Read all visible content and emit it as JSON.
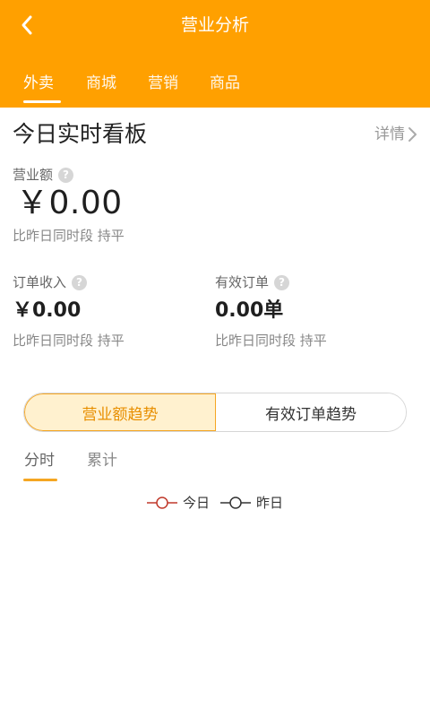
{
  "header": {
    "title": "营业分析",
    "back_icon": "chevron-left-icon",
    "bg_color": "#FFA000",
    "tabs": [
      {
        "label": "外卖",
        "active": true
      },
      {
        "label": "商城",
        "active": false
      },
      {
        "label": "营销",
        "active": false
      },
      {
        "label": "商品",
        "active": false
      }
    ]
  },
  "board": {
    "title": "今日实时看板",
    "detail_label": "详情",
    "revenue": {
      "label": "营业额",
      "value": "￥0.00",
      "compare": "比昨日同时段 持平"
    },
    "order_income": {
      "label": "订单收入",
      "value": "￥0.00",
      "compare": "比昨日同时段 持平"
    },
    "valid_orders": {
      "label": "有效订单",
      "value": "0.00单",
      "compare": "比昨日同时段 持平"
    }
  },
  "trend": {
    "switch": [
      {
        "label": "营业额趋势",
        "active": true
      },
      {
        "label": "有效订单趋势",
        "active": false
      }
    ],
    "sub_tabs": [
      {
        "label": "分时",
        "active": true
      },
      {
        "label": "累计",
        "active": false
      }
    ],
    "legend": [
      {
        "label": "今日",
        "color": "#C0392B"
      },
      {
        "label": "昨日",
        "color": "#333333"
      }
    ],
    "accent_color": "#F5A623"
  }
}
